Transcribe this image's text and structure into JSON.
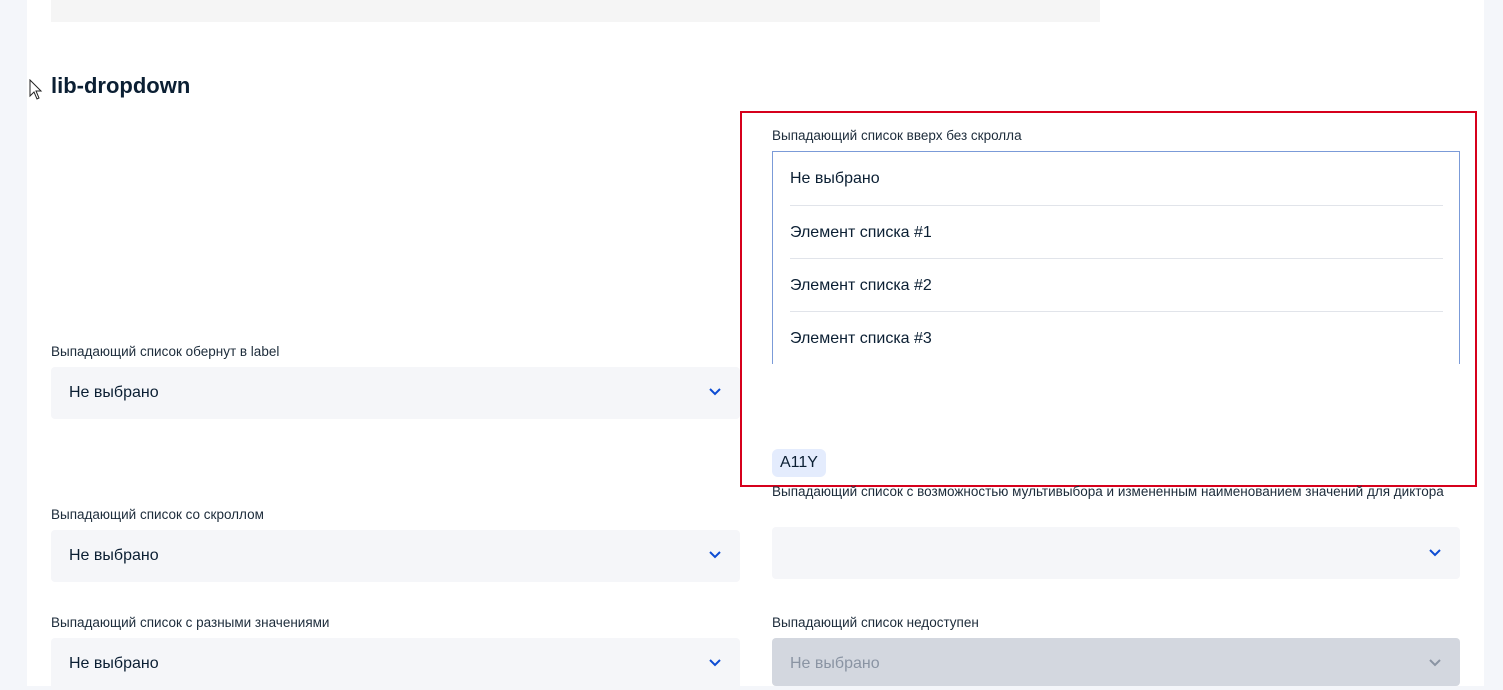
{
  "section": {
    "title": "lib-dropdown"
  },
  "dropdown_up": {
    "label": "Выпадающий список вверх без скролла",
    "options": [
      "Не выбрано",
      "Элемент списка #1",
      "Элемент списка #2",
      "Элемент списка #3"
    ]
  },
  "dropdown_label": {
    "label": "Выпадающий список обернут в label",
    "value": "Не выбрано"
  },
  "a11y_badge": "A11Y",
  "dropdown_multi": {
    "label": "Выпадающий список с возможностью мультивыбора и измененным наименованием значений для диктора",
    "value": ""
  },
  "dropdown_scroll": {
    "label": "Выпадающий список со скроллом",
    "value": "Не выбрано"
  },
  "dropdown_values": {
    "label": "Выпадающий список с разными значениями",
    "value": "Не выбрано"
  },
  "dropdown_disabled": {
    "label": "Выпадающий список недоступен",
    "value": "Не выбрано"
  },
  "colors": {
    "accent": "#0d4cd3",
    "highlight": "#d6001c",
    "field_bg": "#f5f6f9",
    "disabled_bg": "#d3d7df"
  }
}
